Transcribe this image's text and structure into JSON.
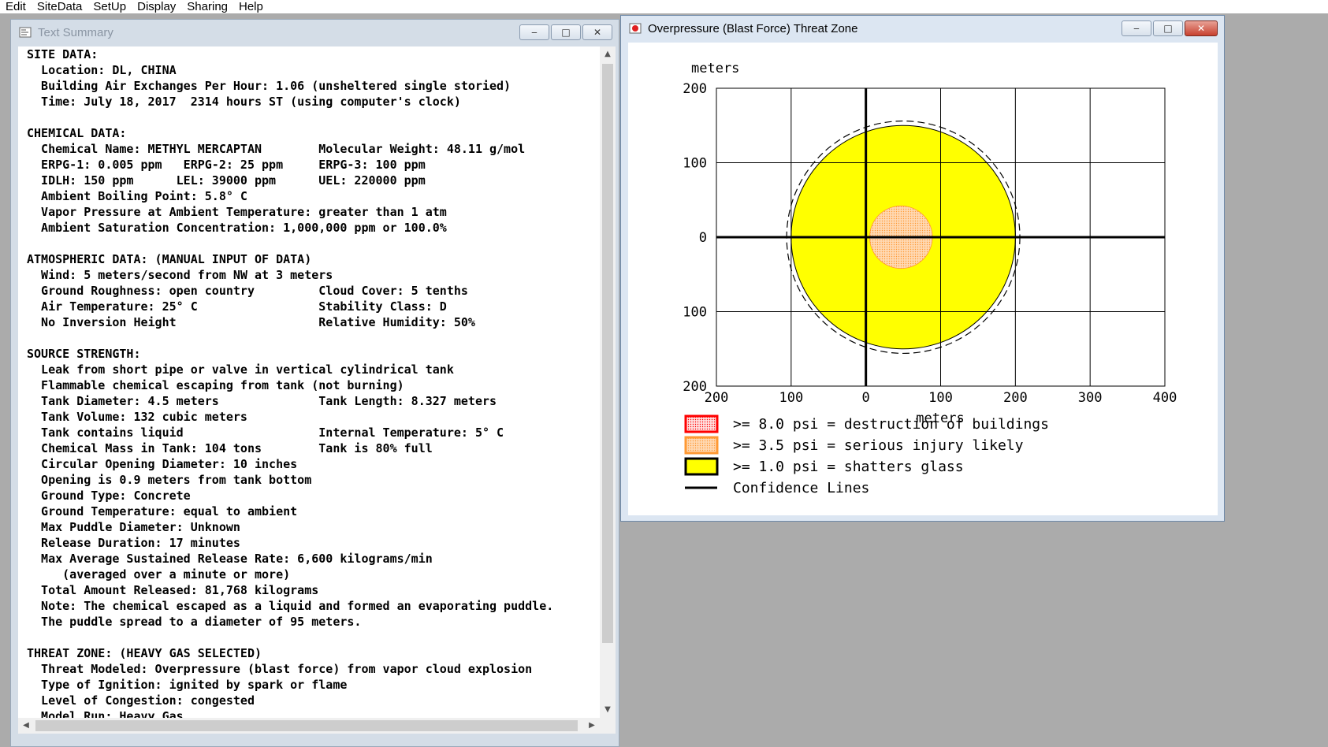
{
  "menu": [
    "Edit",
    "SiteData",
    "SetUp",
    "Display",
    "Sharing",
    "Help"
  ],
  "text_window": {
    "title": "Text Summary",
    "lines": [
      "SITE DATA:",
      "  Location: DL, CHINA",
      "  Building Air Exchanges Per Hour: 1.06 (unsheltered single storied)",
      "  Time: July 18, 2017  2314 hours ST (using computer's clock)",
      "",
      "CHEMICAL DATA:",
      "  Chemical Name: METHYL MERCAPTAN        Molecular Weight: 48.11 g/mol",
      "  ERPG-1: 0.005 ppm   ERPG-2: 25 ppm     ERPG-3: 100 ppm",
      "  IDLH: 150 ppm      LEL: 39000 ppm      UEL: 220000 ppm",
      "  Ambient Boiling Point: 5.8° C",
      "  Vapor Pressure at Ambient Temperature: greater than 1 atm",
      "  Ambient Saturation Concentration: 1,000,000 ppm or 100.0%",
      "",
      "ATMOSPHERIC DATA: (MANUAL INPUT OF DATA)",
      "  Wind: 5 meters/second from NW at 3 meters",
      "  Ground Roughness: open country         Cloud Cover: 5 tenths",
      "  Air Temperature: 25° C                 Stability Class: D",
      "  No Inversion Height                    Relative Humidity: 50%",
      "",
      "SOURCE STRENGTH:",
      "  Leak from short pipe or valve in vertical cylindrical tank",
      "  Flammable chemical escaping from tank (not burning)",
      "  Tank Diameter: 4.5 meters              Tank Length: 8.327 meters",
      "  Tank Volume: 132 cubic meters",
      "  Tank contains liquid                   Internal Temperature: 5° C",
      "  Chemical Mass in Tank: 104 tons        Tank is 80% full",
      "  Circular Opening Diameter: 10 inches",
      "  Opening is 0.9 meters from tank bottom",
      "  Ground Type: Concrete",
      "  Ground Temperature: equal to ambient",
      "  Max Puddle Diameter: Unknown",
      "  Release Duration: 17 minutes",
      "  Max Average Sustained Release Rate: 6,600 kilograms/min",
      "     (averaged over a minute or more)",
      "  Total Amount Released: 81,768 kilograms",
      "  Note: The chemical escaped as a liquid and formed an evaporating puddle.",
      "  The puddle spread to a diameter of 95 meters.",
      "",
      "THREAT ZONE: (HEAVY GAS SELECTED)",
      "  Threat Modeled: Overpressure (blast force) from vapor cloud explosion",
      "  Type of Ignition: ignited by spark or flame",
      "  Level of Congestion: congested",
      "  Model Run: Heavy Gas"
    ]
  },
  "threat_window": {
    "title": "Overpressure (Blast Force) Threat Zone",
    "colors": {
      "red_zone": "#ff0000",
      "orange_zone": "#ff9933",
      "yellow_zone": "#ffff00",
      "confidence": "#000000"
    },
    "legend": [
      {
        "label": ">= 8.0 psi = destruction of buildings",
        "color": "#ff0000",
        "type": "dotted"
      },
      {
        "label": ">= 3.5 psi = serious injury likely",
        "color": "#ff9933",
        "type": "dotted"
      },
      {
        "label": ">= 1.0 psi = shatters glass",
        "color": "#ffff00",
        "type": "solid"
      },
      {
        "label": "Confidence Lines",
        "color": "#000000",
        "type": "line"
      }
    ]
  },
  "chart_data": {
    "type": "scatter",
    "title": "",
    "xlabel": "meters",
    "ylabel": "meters",
    "xlim": [
      -200,
      400
    ],
    "ylim": [
      -200,
      200
    ],
    "x_ticks": [
      "200",
      "100",
      "0",
      "100",
      "200",
      "300",
      "400"
    ],
    "y_ticks": [
      "200",
      "100",
      "0",
      "100",
      "200"
    ],
    "grid": true,
    "zones": [
      {
        "name": ">= 1.0 psi = shatters glass",
        "center": [
          50,
          0
        ],
        "radius": 150,
        "color": "#ffff00"
      },
      {
        "name": ">= 3.5 psi = serious injury likely",
        "center": [
          47,
          0
        ],
        "radius": 42,
        "color": "#ff9933"
      },
      {
        "name": "Confidence Lines",
        "center": [
          50,
          0
        ],
        "radius": 156,
        "color": "#000000",
        "style": "dashed"
      }
    ]
  }
}
